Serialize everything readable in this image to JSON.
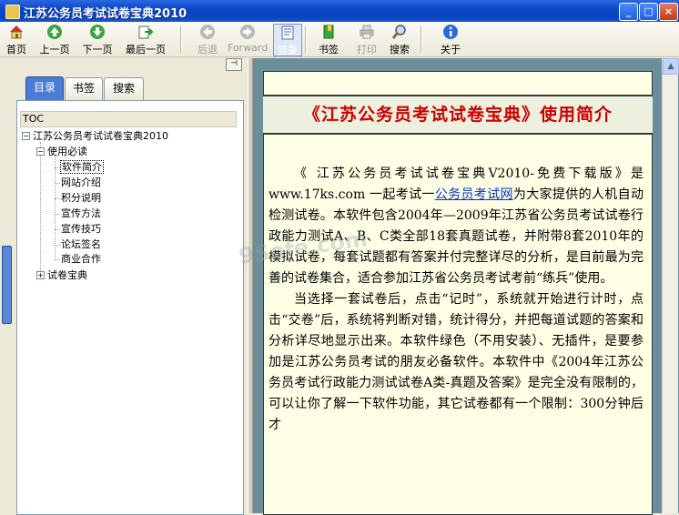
{
  "window": {
    "title": "江苏公务员考试试卷宝典2010"
  },
  "toolbar": {
    "home": "首页",
    "prev": "上一页",
    "next": "下一页",
    "last": "最后一页",
    "back": "后退",
    "forward": "Forward",
    "toc": "目录",
    "bookmark": "书签",
    "print": "打印",
    "search": "搜索",
    "about": "关于"
  },
  "tabs": {
    "toc": "目录",
    "bookmarks": "书签",
    "search": "搜索"
  },
  "tree": {
    "header": "TOC",
    "root": "江苏公务员考试试卷宝典2010",
    "section1": "使用必读",
    "items": [
      "软件简介",
      "网站介绍",
      "积分说明",
      "宣传方法",
      "宣传技巧",
      "论坛签名",
      "商业合作"
    ],
    "section2": "试卷宝典"
  },
  "doc": {
    "heading": "《江苏公务员考试试卷宝典》使用简介",
    "p1_a": "《 江苏公务员考试试卷宝典V2010-免费下载版》是www.17ks.com 一起考试一",
    "p1_link": "公务员考试网",
    "p1_b": "为大家提供的人机自动检测试卷。本软件包含2004年—2009年江苏省公务员考试试卷行政能力测试A、B、C类全部18套真题试卷，并附带8套2010年的模拟试卷，每套试题都有答案并付完整详尽的分析，是目前最为完善的试卷集合，适合参加江苏省公务员考试考前“练兵”使用。",
    "p2": "当选择一套试卷后，点击“记时”，系统就开始进行计时，点击“交卷”后，系统将判断对错，统计得分，并把每道试题的答案和分析详尽地显示出来。本软件绿色（不用安装）、无插件，是要参加是江苏公务员考试的朋友必备软件。本软件中《2004年江苏公务员考试行政能力测试试卷A类-真题及答案》是完全没有限制的，可以让你了解一下软件功能，其它试卷都有一个限制：300分钟后才"
  },
  "watermark": "9Sofe.com"
}
